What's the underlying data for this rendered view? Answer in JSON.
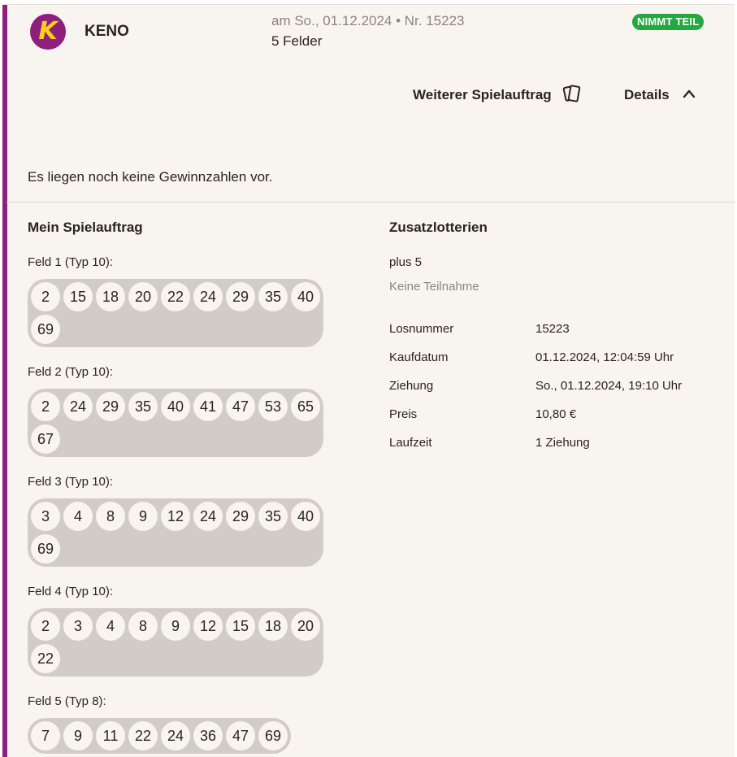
{
  "header": {
    "logo_letter": "K",
    "game_name": "KENO",
    "draw_info": "am So., 01.12.2024 • Nr. 15223",
    "fields_count": "5 Felder",
    "status_badge": "NIMMT TEIL"
  },
  "actions": {
    "repeat_label": "Weiterer Spielauftrag",
    "details_label": "Details"
  },
  "notice": "Es liegen noch keine Gewinnzahlen vor.",
  "my_order": {
    "title": "Mein Spielauftrag",
    "fields": [
      {
        "label": "Feld 1 (Typ 10):",
        "numbers": [
          "2",
          "15",
          "18",
          "20",
          "22",
          "24",
          "29",
          "35",
          "40",
          "69"
        ]
      },
      {
        "label": "Feld 2 (Typ 10):",
        "numbers": [
          "2",
          "24",
          "29",
          "35",
          "40",
          "41",
          "47",
          "53",
          "65",
          "67"
        ]
      },
      {
        "label": "Feld 3 (Typ 10):",
        "numbers": [
          "3",
          "4",
          "8",
          "9",
          "12",
          "24",
          "29",
          "35",
          "40",
          "69"
        ]
      },
      {
        "label": "Feld 4 (Typ 10):",
        "numbers": [
          "2",
          "3",
          "4",
          "8",
          "9",
          "12",
          "15",
          "18",
          "20",
          "22"
        ]
      },
      {
        "label": "Feld 5 (Typ 8):",
        "numbers": [
          "7",
          "9",
          "11",
          "22",
          "24",
          "36",
          "47",
          "69"
        ]
      }
    ]
  },
  "extras": {
    "title": "Zusatzlotterien",
    "plus5_label": "plus 5",
    "plus5_status": "Keine Teilnahme",
    "info": [
      {
        "label": "Losnummer",
        "value": "15223"
      },
      {
        "label": "Kaufdatum",
        "value": "01.12.2024, 12:04:59 Uhr"
      },
      {
        "label": "Ziehung",
        "value": "So., 01.12.2024, 19:10 Uhr"
      },
      {
        "label": "Preis",
        "value": "10,80 €"
      },
      {
        "label": "Laufzeit",
        "value": "1 Ziehung"
      }
    ]
  },
  "colors": {
    "accent": "#8e1f7d",
    "logo_letter": "#f6cf1a",
    "badge": "#23a93f",
    "background": "#f8f5f0",
    "number_box": "#d3ccc6"
  },
  "icons": {
    "repeat": "tickets-icon",
    "details": "chevron-up-icon"
  }
}
